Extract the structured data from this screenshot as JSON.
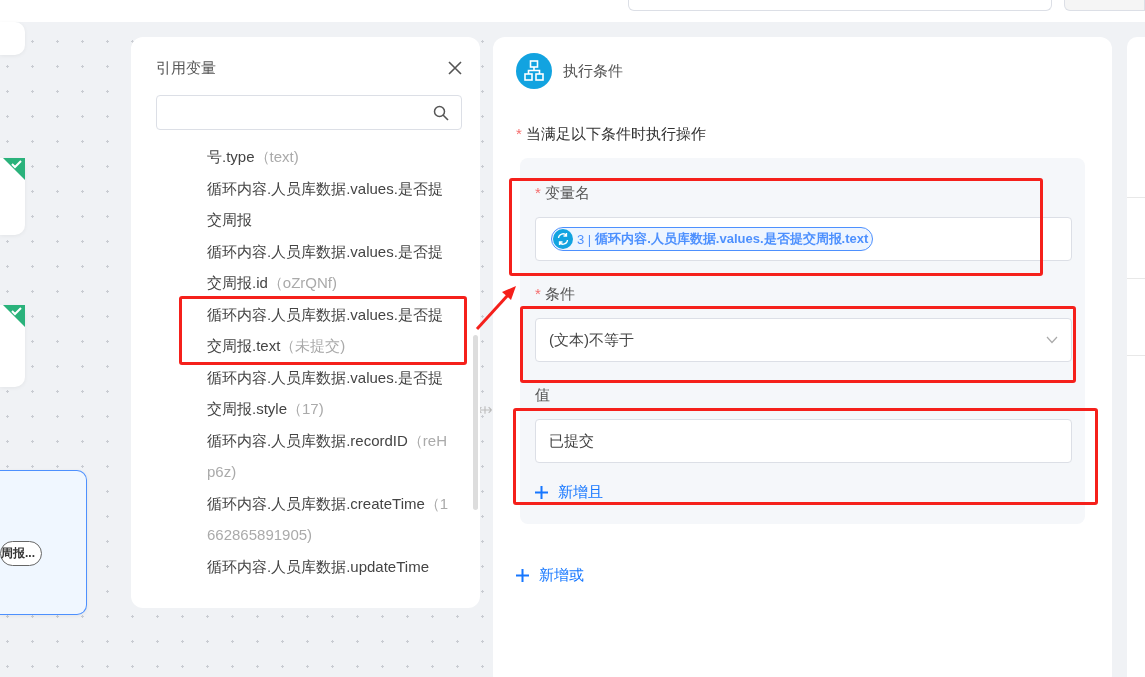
{
  "canvas_nodes": [
    {
      "done": false,
      "selected": false
    },
    {
      "done": true,
      "selected": false
    },
    {
      "done": true,
      "selected": false
    },
    {
      "done": false,
      "selected": true,
      "pill": "周报..."
    }
  ],
  "variable_panel": {
    "title": "引用变量",
    "items": [
      {
        "name": "号.type",
        "value": "（text)",
        "highlighted": false
      },
      {
        "name": "循环内容.人员库数据.values.是否提交周报",
        "highlighted": false
      },
      {
        "name": "循环内容.人员库数据.values.是否提交周报.id",
        "value": "（oZrQNf)",
        "highlighted": false
      },
      {
        "name": "循环内容.人员库数据.values.是否提交周报.text",
        "value": "（未提交)",
        "highlighted": true
      },
      {
        "name": "循环内容.人员库数据.values.是否提交周报.style",
        "value": "（17)",
        "highlighted": false
      },
      {
        "name": "循环内容.人员库数据.recordID",
        "value": "（reHp6z)",
        "highlighted": false
      },
      {
        "name": "循环内容.人员库数据.createTime",
        "value": "（1662865891905)",
        "highlighted": false
      },
      {
        "name": "循环内容.人员库数据.updateTime",
        "highlighted": false
      }
    ]
  },
  "condition_panel": {
    "title": "执行条件",
    "rule_label": "当满足以下条件时执行操作",
    "rule_mark": "*",
    "fields": [
      {
        "kind": "tag",
        "label": "变量名",
        "required_mark": "*",
        "value": "3 | **循环内容.人员库数据.values.是否提交周报.text**"
      },
      {
        "kind": "select",
        "label": "条件",
        "required_mark": "*",
        "value": "(文本)不等于"
      },
      {
        "kind": "input",
        "label": "值",
        "value": "已提交"
      }
    ],
    "add_and": "新增且",
    "add_or": "新增或"
  }
}
